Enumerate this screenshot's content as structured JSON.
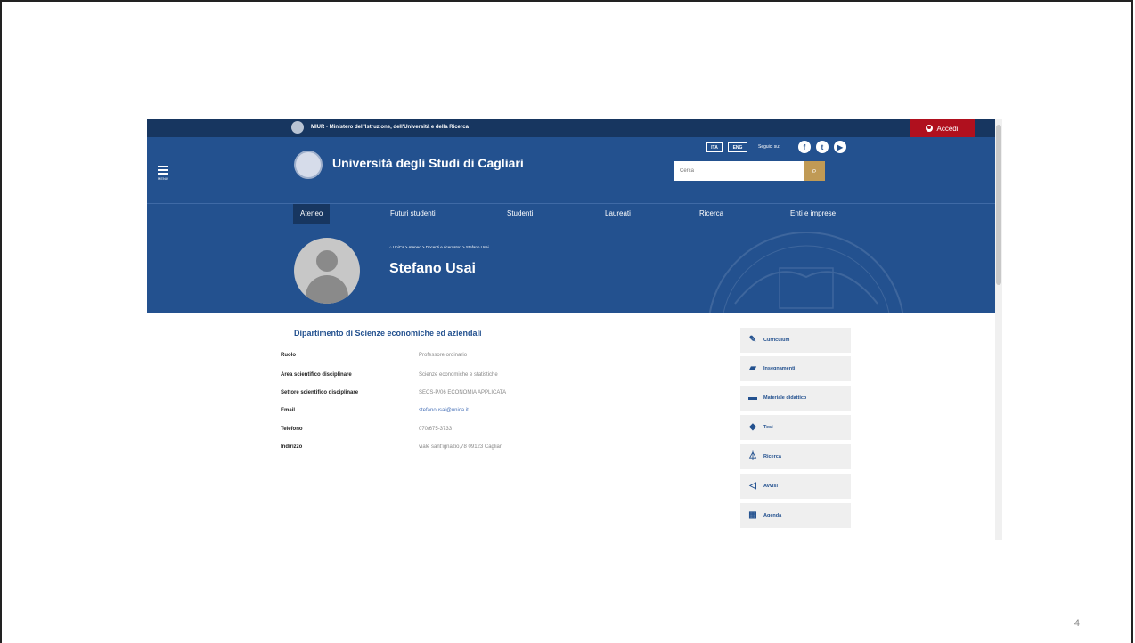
{
  "slide": {
    "number": "4"
  },
  "topbar": {
    "miur_text": "MIUR - Ministero dell'Istruzione, dell'Università e della Ricerca",
    "login_label": "Accedi"
  },
  "header": {
    "menu_label": "MENU",
    "site_title": "Università degli Studi di Cagliari",
    "lang_ita": "ITA",
    "lang_eng": "ENG",
    "follow_label": "Seguici su:",
    "search_placeholder": "Cerca",
    "search_icon": "search-icon",
    "social": [
      "facebook-icon",
      "twitter-icon",
      "youtube-icon"
    ]
  },
  "nav": {
    "items": [
      {
        "label": "Ateneo"
      },
      {
        "label": "Futuri studenti"
      },
      {
        "label": "Studenti"
      },
      {
        "label": "Laureati"
      },
      {
        "label": "Ricerca"
      },
      {
        "label": "Enti e imprese"
      }
    ]
  },
  "hero": {
    "breadcrumb": "UniCa > Ateneo > Docenti e ricercatori > Stefano Usai",
    "name": "Stefano Usai"
  },
  "content": {
    "department": "Dipartimento di Scienze economiche ed aziendali",
    "rows": [
      {
        "label": "Ruolo",
        "value": "Professore ordinario"
      },
      {
        "label": "Area scientifico disciplinare",
        "value": "Scienze economiche e statistiche"
      },
      {
        "label": "Settore scientifico disciplinare",
        "value": "SECS-P/06 ECONOMIA APPLICATA"
      },
      {
        "label": "Email",
        "value": "stefanousai@unica.it"
      },
      {
        "label": "Telefono",
        "value": "070/675-3733"
      },
      {
        "label": "Indirizzo",
        "value": "viale sant'ignazio,78 09123 Cagliari"
      }
    ]
  },
  "sidebar": {
    "buttons": [
      {
        "label": "Curriculum",
        "icon": "edit-icon"
      },
      {
        "label": "Insegnamenti",
        "icon": "book-icon"
      },
      {
        "label": "Materiale didattico",
        "icon": "folder-icon"
      },
      {
        "label": "Tesi",
        "icon": "graduation-cap-icon"
      },
      {
        "label": "Ricerca",
        "icon": "flask-icon"
      },
      {
        "label": "Avvisi",
        "icon": "megaphone-icon"
      },
      {
        "label": "Agenda",
        "icon": "calendar-icon"
      }
    ]
  },
  "colors": {
    "primary_blue": "#23518f",
    "dark_blue": "#173660",
    "login_red": "#b0101e",
    "search_gold": "#c09a55"
  }
}
